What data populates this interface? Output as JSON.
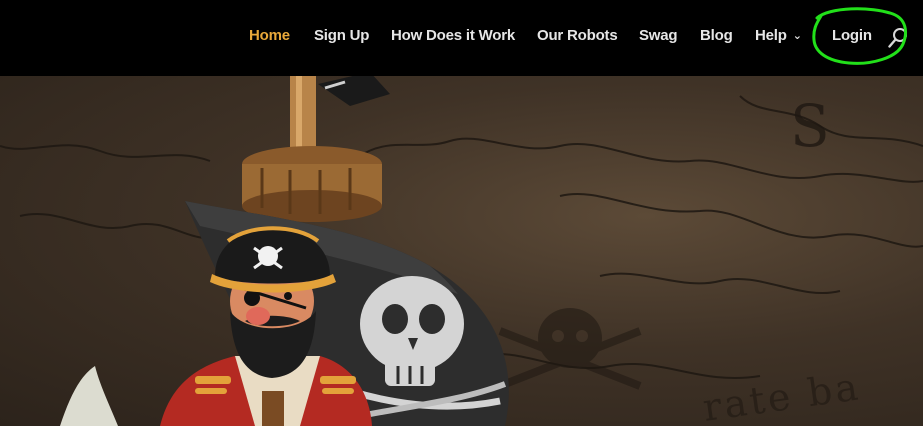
{
  "nav": {
    "items": [
      {
        "label": "Home",
        "active": true
      },
      {
        "label": "Sign Up"
      },
      {
        "label": "How Does it Work"
      },
      {
        "label": "Our Robots"
      },
      {
        "label": "Swag"
      },
      {
        "label": "Blog"
      },
      {
        "label": "Help",
        "has_dropdown": true
      },
      {
        "label": "Login",
        "annotated": true
      }
    ],
    "search_icon": "search-icon"
  },
  "hero": {
    "map_letter": "S",
    "map_text": "rate ba"
  },
  "colors": {
    "header_bg": "#000000",
    "active_link": "#e8a83a",
    "link": "#e6e6e6",
    "annotation": "#22e01a",
    "map_dark": "#2c231b"
  }
}
